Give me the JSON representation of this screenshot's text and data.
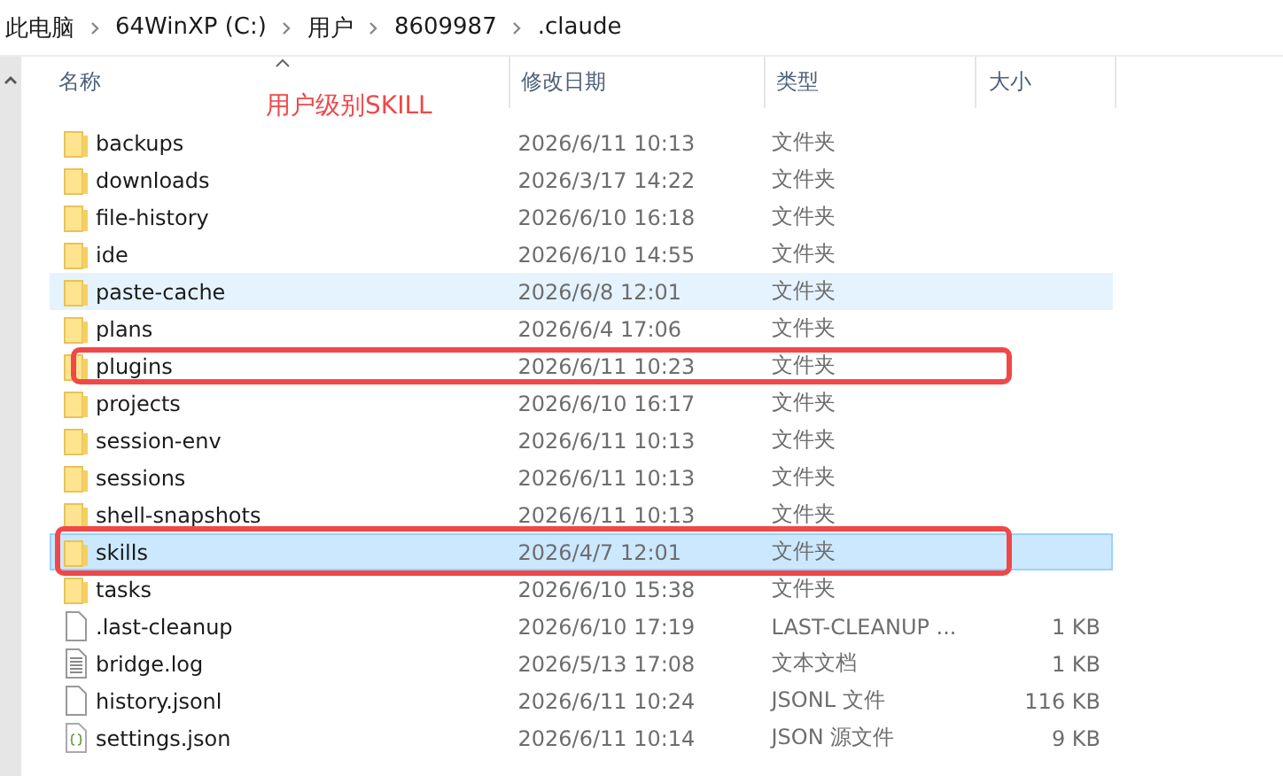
{
  "breadcrumb": [
    "此电脑",
    "64WinXP (C:)",
    "用户",
    "8609987",
    ".claude"
  ],
  "columns": [
    {
      "label": "名称",
      "sorted": true
    },
    {
      "label": "修改日期",
      "sorted": false
    },
    {
      "label": "类型",
      "sorted": false
    },
    {
      "label": "大小",
      "sorted": false
    }
  ],
  "annotation": {
    "label": "用户级别SKILL"
  },
  "rows": [
    {
      "kind": "folder",
      "name": "backups",
      "modified": "2026/6/11 10:13",
      "type": "文件夹",
      "selected": false,
      "hovered": false,
      "highlighted": false
    },
    {
      "kind": "folder",
      "name": "downloads",
      "modified": "2026/3/17 14:22",
      "type": "文件夹",
      "selected": false,
      "hovered": false,
      "highlighted": false
    },
    {
      "kind": "folder",
      "name": "file-history",
      "modified": "2026/6/10 16:18",
      "type": "文件夹",
      "selected": false,
      "hovered": false,
      "highlighted": false
    },
    {
      "kind": "folder",
      "name": "ide",
      "modified": "2026/6/10 14:55",
      "type": "文件夹",
      "selected": false,
      "hovered": false,
      "highlighted": false
    },
    {
      "kind": "folder",
      "name": "paste-cache",
      "modified": "2026/6/8 12:01",
      "type": "文件夹",
      "selected": false,
      "hovered": true,
      "highlighted": false
    },
    {
      "kind": "folder",
      "name": "plans",
      "modified": "2026/6/4 17:06",
      "type": "文件夹",
      "selected": false,
      "hovered": false,
      "highlighted": false
    },
    {
      "kind": "folder",
      "name": "plugins",
      "modified": "2026/6/11 10:23",
      "type": "文件夹",
      "selected": false,
      "hovered": false,
      "highlighted": true
    },
    {
      "kind": "folder",
      "name": "projects",
      "modified": "2026/6/10 16:17",
      "type": "文件夹",
      "selected": false,
      "hovered": false,
      "highlighted": false
    },
    {
      "kind": "folder",
      "name": "session-env",
      "modified": "2026/6/11 10:13",
      "type": "文件夹",
      "selected": false,
      "hovered": false,
      "highlighted": false
    },
    {
      "kind": "folder",
      "name": "sessions",
      "modified": "2026/6/11 10:13",
      "type": "文件夹",
      "selected": false,
      "hovered": false,
      "highlighted": false
    },
    {
      "kind": "folder",
      "name": "shell-snapshots",
      "modified": "2026/6/11 10:13",
      "type": "文件夹",
      "selected": false,
      "hovered": false,
      "highlighted": false
    },
    {
      "kind": "folder",
      "name": "skills",
      "modified": "2026/4/7 12:01",
      "type": "文件夹",
      "selected": true,
      "hovered": false,
      "highlighted": true
    },
    {
      "kind": "folder",
      "name": "tasks",
      "modified": "2026/6/10 15:38",
      "type": "文件夹",
      "selected": false,
      "hovered": false,
      "highlighted": false
    },
    {
      "kind": "file",
      "name": ".last-cleanup",
      "modified": "2026/6/10 17:19",
      "type": "LAST-CLEANUP ...",
      "size": "1 KB",
      "selected": false,
      "hovered": false,
      "highlighted": false
    },
    {
      "kind": "text",
      "name": "bridge.log",
      "modified": "2026/5/13 17:08",
      "type": "文本文档",
      "size": "1 KB",
      "selected": false,
      "hovered": false,
      "highlighted": false
    },
    {
      "kind": "file",
      "name": "history.jsonl",
      "modified": "2026/6/11 10:24",
      "type": "JSONL 文件",
      "size": "116 KB",
      "selected": false,
      "hovered": false,
      "highlighted": false
    },
    {
      "kind": "json",
      "name": "settings.json",
      "modified": "2026/6/11 10:14",
      "type": "JSON 源文件",
      "size": "9 KB",
      "selected": false,
      "hovered": false,
      "highlighted": false
    }
  ]
}
